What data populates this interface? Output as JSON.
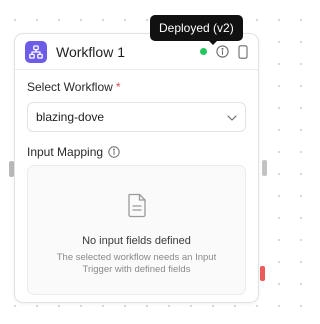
{
  "node": {
    "title": "Workflow 1",
    "icon": "workflow-icon",
    "accent_color": "#6c5ce7",
    "status_color": "#22c55e",
    "status": "deployed"
  },
  "tooltip": {
    "text": "Deployed (v2)"
  },
  "select_workflow": {
    "label": "Select Workflow",
    "required_mark": "*",
    "value": "blazing-dove"
  },
  "input_mapping": {
    "label": "Input Mapping",
    "empty_title": "No input fields defined",
    "empty_description": "The selected workflow needs an Input Trigger with defined fields"
  }
}
